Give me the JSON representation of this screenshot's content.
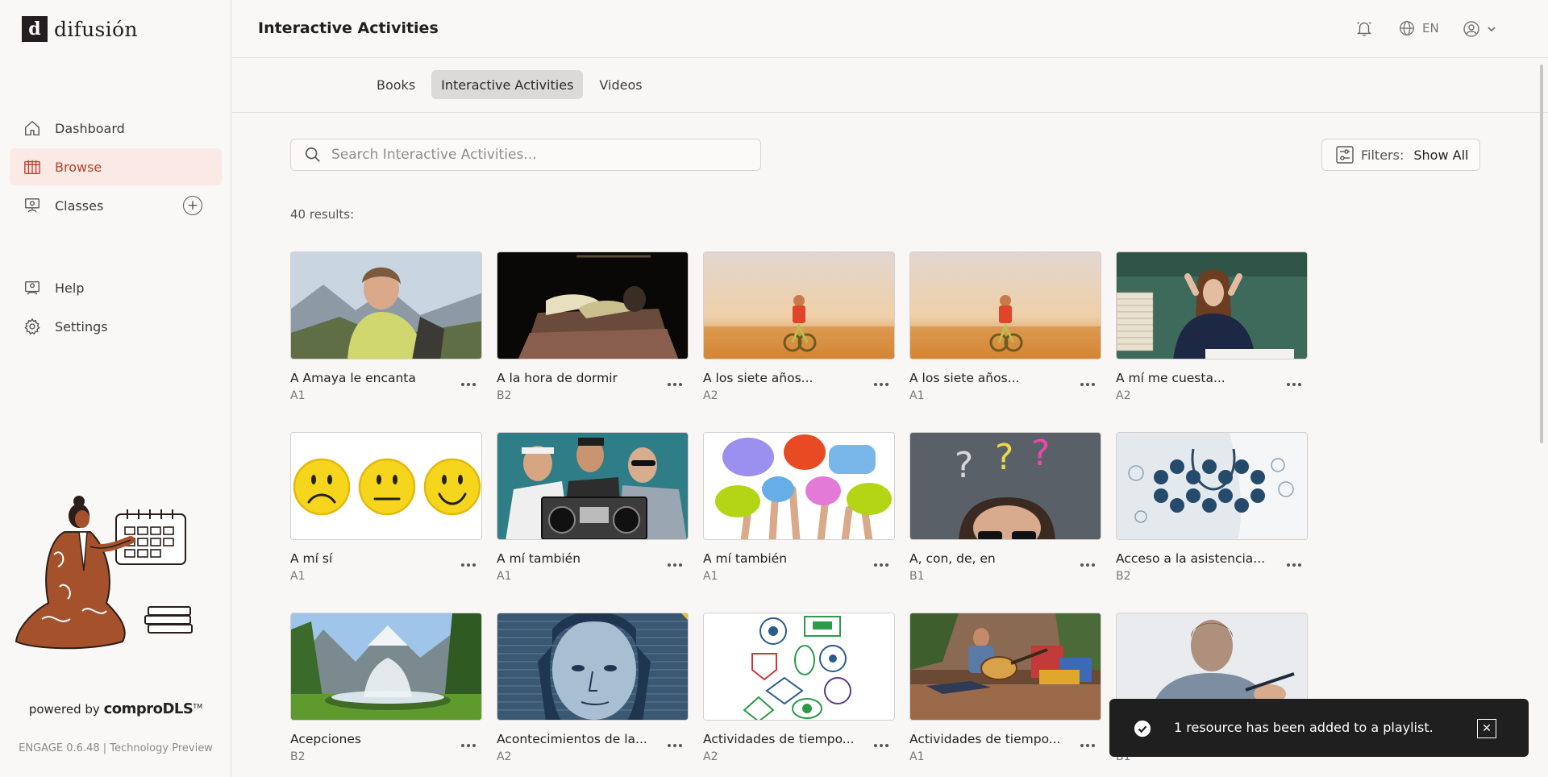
{
  "brand": {
    "logo_mark": "d",
    "name": "difusión"
  },
  "sidebar": {
    "items": [
      {
        "label": "Dashboard",
        "icon": "home-icon"
      },
      {
        "label": "Browse",
        "icon": "library-icon",
        "active": true
      },
      {
        "label": "Classes",
        "icon": "classroom-icon",
        "add": "+"
      }
    ],
    "items2": [
      {
        "label": "Help",
        "icon": "help-icon"
      },
      {
        "label": "Settings",
        "icon": "gear-icon"
      }
    ],
    "powered_prefix": "powered by",
    "powered_brand": "comproDLS",
    "powered_tm": "TM",
    "version": "ENGAGE 0.6.48 | Technology Preview"
  },
  "header": {
    "title": "Interactive Activities",
    "lang": "EN"
  },
  "tabs": [
    {
      "label": "Books"
    },
    {
      "label": "Interactive Activities",
      "active": true
    },
    {
      "label": "Videos"
    }
  ],
  "search": {
    "placeholder": "Search Interactive Activities..."
  },
  "filters": {
    "label": "Filters:",
    "value": "Show All"
  },
  "results_label": "40 results:",
  "cards": [
    {
      "title": "A Amaya le encanta",
      "level": "A1"
    },
    {
      "title": "A la hora de dormir",
      "level": "B2"
    },
    {
      "title": "A los siete años...",
      "level": "A2"
    },
    {
      "title": "A los siete años...",
      "level": "A1"
    },
    {
      "title": "A mí me cuesta...",
      "level": "A2"
    },
    {
      "title": "A mí sí",
      "level": "A1"
    },
    {
      "title": "A mí también",
      "level": "A1"
    },
    {
      "title": "A mí también",
      "level": "A1"
    },
    {
      "title": "A, con, de, en",
      "level": "B1"
    },
    {
      "title": "Acceso a la asistencia...",
      "level": "B2"
    },
    {
      "title": "Acepciones",
      "level": "B2"
    },
    {
      "title": "Acontecimientos de la...",
      "level": "A2"
    },
    {
      "title": "Actividades de tiempo...",
      "level": "A2"
    },
    {
      "title": "Actividades de tiempo...",
      "level": "A1"
    },
    {
      "title": "",
      "level": "B1"
    }
  ],
  "toast": {
    "message": "1 resource has been added to a playlist.",
    "close": "✕"
  },
  "colors": {
    "accent": "#b9432a",
    "active_bg": "#fbe9e5",
    "toast_bg": "#1f1f1f"
  }
}
